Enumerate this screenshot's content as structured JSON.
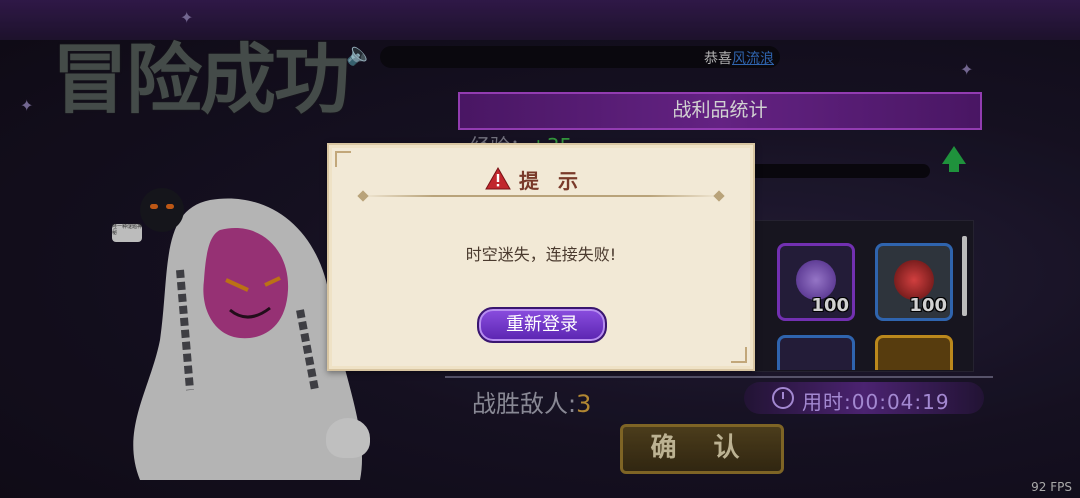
{
  "result": {
    "title": "冒险成功"
  },
  "announcement": {
    "prefix": "恭喜",
    "player_name": "风流浪"
  },
  "loot": {
    "banner": "战利品统计",
    "exp_label": "经验：",
    "exp_value": "+35",
    "items": [
      {
        "icon": "purple-crystal-icon",
        "qty": "100"
      },
      {
        "icon": "red-rune-stone-icon",
        "qty": "100"
      },
      {
        "icon": "scroll-icon",
        "qty": ""
      },
      {
        "icon": "gold-coin-pile-icon",
        "qty": ""
      }
    ]
  },
  "stats": {
    "enemies_label": "战胜敌人:",
    "enemies_value": "3",
    "time_label": "用时:",
    "time_value": "00:04:19"
  },
  "confirm_button": "确 认",
  "dialog": {
    "title": "提 示",
    "message": "时空迷失，连接失败!",
    "button": "重新登录"
  },
  "speech_bubble": "哇一种谜题神秘",
  "fps": "92 FPS",
  "colors": {
    "accent": "#7a2aa0",
    "warn": "#c1272d",
    "gold": "#d8a53d"
  }
}
